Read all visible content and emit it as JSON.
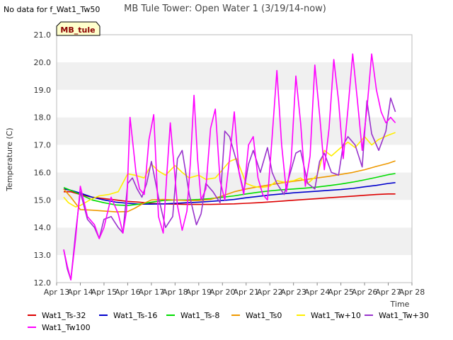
{
  "no_data_text": "No data for f_Wat1_Tw50",
  "station_tag": "MB_tule",
  "chart_data": {
    "type": "line",
    "title": "MB Tule Tower: Open Water 1 (3/19/14-now)",
    "xlabel": "Time",
    "ylabel": "Temperature (C)",
    "xlim": [
      "Apr 13",
      "Apr 28"
    ],
    "ylim": [
      12.0,
      21.0
    ],
    "x_ticks": [
      "Apr 13",
      "Apr 14",
      "Apr 15",
      "Apr 16",
      "Apr 17",
      "Apr 18",
      "Apr 19",
      "Apr 20",
      "Apr 21",
      "Apr 22",
      "Apr 23",
      "Apr 24",
      "Apr 25",
      "Apr 26",
      "Apr 27",
      "Apr 28"
    ],
    "y_ticks": [
      "12.0",
      "13.0",
      "14.0",
      "15.0",
      "16.0",
      "17.0",
      "18.0",
      "19.0",
      "20.0",
      "21.0"
    ],
    "grid": "horizontal bands",
    "legend_position": "bottom",
    "series": [
      {
        "name": "Wat1_Ts-32",
        "color": "#dd0000",
        "x": [
          13.3,
          13.6,
          14.0,
          14.5,
          15.0,
          15.5,
          16.0,
          16.5,
          17.0,
          17.5,
          18.0,
          18.5,
          19.0,
          19.5,
          20.0,
          20.5,
          21.0,
          21.5,
          22.0,
          22.5,
          23.0,
          23.5,
          24.0,
          24.5,
          25.0,
          25.5,
          26.0,
          26.5,
          27.0,
          27.3
        ],
        "y": [
          15.3,
          15.3,
          15.2,
          15.1,
          15.05,
          15.0,
          14.95,
          14.92,
          14.88,
          14.86,
          14.85,
          14.84,
          14.84,
          14.84,
          14.85,
          14.86,
          14.88,
          14.9,
          14.93,
          14.96,
          14.99,
          15.02,
          15.05,
          15.08,
          15.11,
          15.14,
          15.17,
          15.2,
          15.22,
          15.22
        ]
      },
      {
        "name": "Wat1_Ts-16",
        "color": "#0000cc",
        "x": [
          13.3,
          13.6,
          14.0,
          14.5,
          15.0,
          15.5,
          16.0,
          16.5,
          17.0,
          17.5,
          18.0,
          18.5,
          19.0,
          19.5,
          20.0,
          20.5,
          21.0,
          21.5,
          22.0,
          22.5,
          23.0,
          23.5,
          24.0,
          24.5,
          25.0,
          25.5,
          26.0,
          26.5,
          27.0,
          27.3
        ],
        "y": [
          15.4,
          15.35,
          15.25,
          15.1,
          15.0,
          14.92,
          14.88,
          14.85,
          14.85,
          14.86,
          14.88,
          14.9,
          14.92,
          14.95,
          14.98,
          15.02,
          15.08,
          15.13,
          15.18,
          15.22,
          15.26,
          15.29,
          15.32,
          15.35,
          15.38,
          15.42,
          15.48,
          15.53,
          15.6,
          15.63
        ]
      },
      {
        "name": "Wat1_Ts-8",
        "color": "#00dd00",
        "x": [
          13.3,
          13.6,
          14.0,
          14.5,
          15.0,
          15.5,
          16.0,
          16.5,
          17.0,
          17.5,
          18.0,
          18.5,
          19.0,
          19.5,
          20.0,
          20.5,
          21.0,
          21.5,
          22.0,
          22.5,
          23.0,
          23.5,
          24.0,
          24.5,
          25.0,
          25.5,
          26.0,
          26.5,
          27.0,
          27.3
        ],
        "y": [
          15.45,
          15.35,
          15.2,
          15.0,
          14.9,
          14.82,
          14.8,
          14.85,
          14.92,
          14.98,
          15.0,
          15.0,
          15.02,
          15.05,
          15.1,
          15.15,
          15.22,
          15.28,
          15.33,
          15.37,
          15.4,
          15.43,
          15.47,
          15.52,
          15.58,
          15.65,
          15.73,
          15.82,
          15.92,
          15.96
        ]
      },
      {
        "name": "Wat1_Ts0",
        "color": "#ee9900",
        "x": [
          13.3,
          13.6,
          14.0,
          14.5,
          15.0,
          15.5,
          16.0,
          16.3,
          16.6,
          17.0,
          17.5,
          18.0,
          18.5,
          19.0,
          19.5,
          20.0,
          20.5,
          21.0,
          21.5,
          22.0,
          22.5,
          23.0,
          23.5,
          24.0,
          24.5,
          25.0,
          25.5,
          26.0,
          26.5,
          27.0,
          27.3
        ],
        "y": [
          15.4,
          15.1,
          14.65,
          14.63,
          14.6,
          14.57,
          14.58,
          14.7,
          14.85,
          15.0,
          15.02,
          15.0,
          14.98,
          14.98,
          15.02,
          15.15,
          15.3,
          15.4,
          15.48,
          15.55,
          15.62,
          15.68,
          15.74,
          15.8,
          15.86,
          15.93,
          16.0,
          16.1,
          16.22,
          16.33,
          16.42
        ]
      },
      {
        "name": "Wat1_Tw+10",
        "color": "#ffee00",
        "x": [
          13.3,
          13.5,
          13.8,
          14.0,
          14.4,
          14.8,
          15.2,
          15.6,
          16.0,
          16.3,
          16.7,
          17.0,
          17.3,
          17.6,
          18.0,
          18.3,
          18.6,
          19.0,
          19.3,
          19.7,
          20.0,
          20.3,
          20.6,
          21.0,
          21.3,
          21.6,
          22.0,
          22.3,
          22.6,
          23.0,
          23.3,
          23.6,
          24.0,
          24.3,
          24.6,
          25.0,
          25.3,
          25.6,
          26.0,
          26.3,
          26.6,
          27.0,
          27.3
        ],
        "y": [
          15.1,
          14.9,
          14.75,
          14.8,
          15.0,
          15.15,
          15.2,
          15.3,
          15.95,
          15.9,
          15.8,
          16.3,
          16.05,
          15.9,
          16.25,
          16.0,
          15.8,
          15.9,
          15.75,
          15.8,
          16.1,
          16.4,
          16.5,
          15.6,
          15.5,
          15.45,
          15.5,
          15.7,
          15.65,
          15.7,
          15.8,
          15.6,
          15.9,
          16.8,
          16.6,
          16.9,
          17.1,
          16.9,
          17.3,
          17.0,
          17.2,
          17.35,
          17.45
        ]
      },
      {
        "name": "Wat1_Tw+30",
        "color": "#9933cc",
        "x": [
          13.3,
          13.45,
          13.6,
          13.8,
          14.0,
          14.3,
          14.6,
          14.8,
          15.0,
          15.3,
          15.6,
          15.8,
          16.0,
          16.2,
          16.4,
          16.6,
          16.8,
          17.0,
          17.3,
          17.6,
          17.9,
          18.1,
          18.3,
          18.6,
          18.9,
          19.1,
          19.3,
          19.6,
          19.9,
          20.1,
          20.3,
          20.6,
          20.9,
          21.1,
          21.3,
          21.6,
          21.9,
          22.1,
          22.3,
          22.6,
          22.9,
          23.1,
          23.3,
          23.6,
          23.9,
          24.1,
          24.3,
          24.6,
          24.9,
          25.1,
          25.3,
          25.6,
          25.9,
          26.1,
          26.3,
          26.6,
          26.9,
          27.1,
          27.3
        ],
        "y": [
          13.2,
          12.5,
          12.1,
          13.8,
          15.3,
          14.3,
          14.0,
          13.6,
          14.3,
          14.4,
          14.0,
          13.8,
          15.6,
          15.8,
          15.4,
          15.1,
          15.6,
          16.4,
          15.1,
          14.0,
          14.4,
          16.5,
          16.8,
          15.2,
          14.1,
          14.5,
          15.6,
          15.3,
          14.9,
          17.5,
          17.3,
          16.4,
          15.3,
          16.3,
          16.8,
          16.0,
          16.9,
          16.0,
          15.6,
          15.2,
          16.1,
          16.7,
          16.8,
          15.6,
          15.4,
          16.4,
          16.7,
          16.0,
          15.9,
          17.0,
          17.3,
          17.0,
          16.2,
          18.6,
          17.4,
          16.8,
          17.5,
          18.7,
          18.2
        ]
      },
      {
        "name": "Wat1_Tw100",
        "color": "#ff00ff",
        "x": [
          13.3,
          13.45,
          13.6,
          13.8,
          14.0,
          14.3,
          14.6,
          14.8,
          15.0,
          15.3,
          15.6,
          15.8,
          15.95,
          16.1,
          16.2,
          16.35,
          16.5,
          16.7,
          16.9,
          17.1,
          17.3,
          17.5,
          17.65,
          17.8,
          18.1,
          18.3,
          18.5,
          18.65,
          18.8,
          18.95,
          19.1,
          19.3,
          19.5,
          19.7,
          19.9,
          20.1,
          20.3,
          20.5,
          20.7,
          20.9,
          21.1,
          21.3,
          21.5,
          21.7,
          21.9,
          22.1,
          22.3,
          22.5,
          22.7,
          22.9,
          23.1,
          23.3,
          23.5,
          23.7,
          23.9,
          24.1,
          24.3,
          24.5,
          24.7,
          24.9,
          25.1,
          25.3,
          25.5,
          25.7,
          25.9,
          26.1,
          26.3,
          26.5,
          26.7,
          26.9,
          27.1,
          27.3
        ],
        "y": [
          13.2,
          12.6,
          12.1,
          13.6,
          15.5,
          14.4,
          14.1,
          13.6,
          14.0,
          15.1,
          14.5,
          13.8,
          14.6,
          18.0,
          17.2,
          16.0,
          15.4,
          15.2,
          17.2,
          18.1,
          14.4,
          13.8,
          15.9,
          17.8,
          14.8,
          13.9,
          14.6,
          16.4,
          18.8,
          16.5,
          15.0,
          15.4,
          17.6,
          18.3,
          15.7,
          15.0,
          16.5,
          18.2,
          16.0,
          15.2,
          17.0,
          17.3,
          15.8,
          15.2,
          15.0,
          17.3,
          19.7,
          17.0,
          15.3,
          16.4,
          19.5,
          17.8,
          15.5,
          16.6,
          19.9,
          18.1,
          16.1,
          17.6,
          20.1,
          18.6,
          16.5,
          18.3,
          20.3,
          18.6,
          16.8,
          18.3,
          20.3,
          19.0,
          18.2,
          17.8,
          18.0,
          17.8
        ]
      }
    ]
  }
}
